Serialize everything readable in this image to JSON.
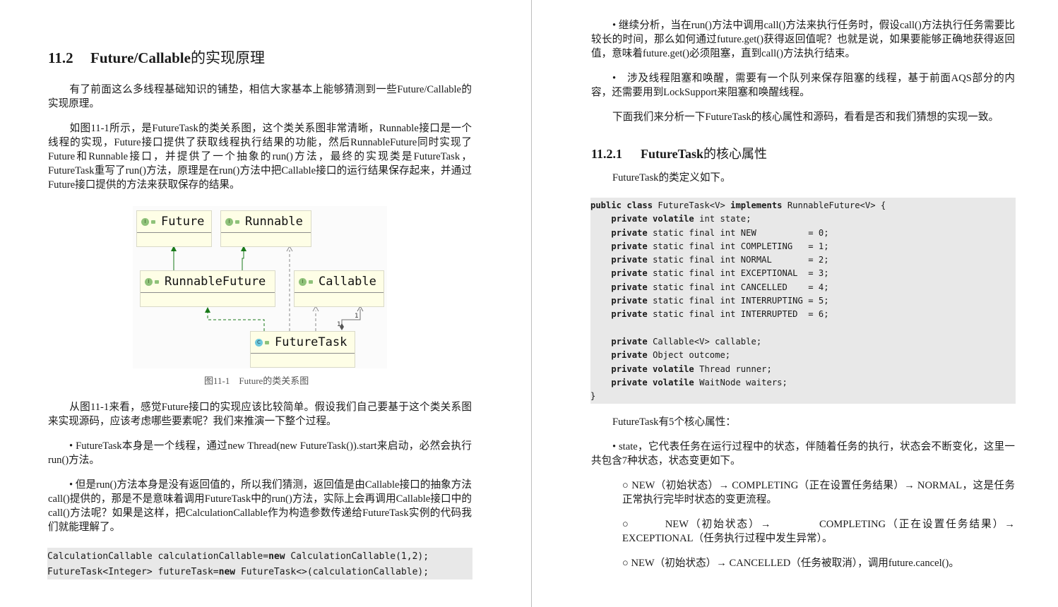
{
  "left_page": {
    "heading": {
      "number": "11.2",
      "title_latin": "Future/Callable",
      "title_zh": "的实现原理"
    },
    "paragraphs": [
      "有了前面这么多线程基础知识的铺垫，相信大家基本上能够猜测到一些Future/Callable的实现原理。",
      "如图11-1所示，是FutureTask的类关系图，这个类关系图非常清晰，Runnable接口是一个线程的实现，Future接口提供了获取线程执行结果的功能，然后RunnableFuture同时实现了Future和Runnable接口，并提供了一个抽象的run()方法，最终的实现类是FutureTask，FutureTask重写了run()方法，原理是在run()方法中把Callable接口的运行结果保存起来，并通过Future接口提供的方法来获取保存的结果。"
    ],
    "figure": {
      "caption": "图11-1　Future的类关系图",
      "nodes": [
        {
          "name": "Future",
          "kind": "I"
        },
        {
          "name": "Runnable",
          "kind": "I"
        },
        {
          "name": "RunnableFuture",
          "kind": "I"
        },
        {
          "name": "Callable",
          "kind": "I"
        },
        {
          "name": "FutureTask",
          "kind": "C"
        }
      ],
      "edges": [
        {
          "from": "RunnableFuture",
          "to": "Future",
          "type": "extends"
        },
        {
          "from": "RunnableFuture",
          "to": "Runnable",
          "type": "extends"
        },
        {
          "from": "FutureTask",
          "to": "RunnableFuture",
          "type": "implements"
        },
        {
          "from": "FutureTask",
          "to": "Runnable",
          "type": "dependency"
        },
        {
          "from": "FutureTask",
          "to": "Callable",
          "type": "dependency"
        },
        {
          "from": "FutureTask",
          "to": "Callable",
          "type": "composition",
          "label_from": "1",
          "label_to": "1"
        }
      ]
    },
    "paragraphs2": [
      "从图11-1来看，感觉Future接口的实现应该比较简单。假设我们自己要基于这个类关系图来实现源码，应该考虑哪些要素呢？我们来推演一下整个过程。",
      "• FutureTask本身是一个线程，通过new Thread(new FutureTask()).start来启动，必然会执行run()方法。",
      "• 但是run()方法本身是没有返回值的，所以我们猜测，返回值是由Callable接口的抽象方法call()提供的，那是不是意味着调用FutureTask中的run()方法，实际上会再调用Callable接口中的call()方法呢？如果是这样，把CalculationCallable作为构造参数传递给FutureTask实例的代码我们就能理解了。"
    ],
    "code": [
      [
        {
          "t": "CalculationCallable calculationCallable="
        },
        {
          "t": "new",
          "b": true
        },
        {
          "t": " CalculationCallable(1,2);"
        }
      ],
      [
        {
          "t": "FutureTask<Integer> futureTask="
        },
        {
          "t": "new",
          "b": true
        },
        {
          "t": " FutureTask<>(calculationCallable);"
        }
      ]
    ]
  },
  "right_page": {
    "paragraphs": [
      "• 继续分析，当在run()方法中调用call()方法来执行任务时，假设call()方法执行任务需要比较长的时间，那么如何通过future.get()获得返回值呢？也就是说，如果要能够正确地获得返回值，意味着future.get()必须阻塞，直到call()方法执行结束。",
      "•　涉及线程阻塞和唤醒，需要有一个队列来保存阻塞的线程，基于前面AQS部分的内容，还需要用到LockSupport来阻塞和唤醒线程。",
      "下面我们来分析一下FutureTask的核心属性和源码，看看是否和我们猜想的实现一致。"
    ],
    "heading": {
      "number": "11.2.1",
      "title_latin": "FutureTask",
      "title_zh": "的核心属性"
    },
    "intro": "FutureTask的类定义如下。",
    "code": [
      [
        {
          "t": "public class",
          "b": true
        },
        {
          "t": " FutureTask<V> "
        },
        {
          "t": "implements",
          "b": true
        },
        {
          "t": " RunnableFuture<V> {"
        }
      ],
      [
        {
          "t": "    "
        },
        {
          "t": "private volatile",
          "b": true
        },
        {
          "t": " int state;"
        }
      ],
      [
        {
          "t": "    "
        },
        {
          "t": "private",
          "b": true
        },
        {
          "t": " static final int NEW          = 0;"
        }
      ],
      [
        {
          "t": "    "
        },
        {
          "t": "private",
          "b": true
        },
        {
          "t": " static final int COMPLETING   = 1;"
        }
      ],
      [
        {
          "t": "    "
        },
        {
          "t": "private",
          "b": true
        },
        {
          "t": " static final int NORMAL       = 2;"
        }
      ],
      [
        {
          "t": "    "
        },
        {
          "t": "private",
          "b": true
        },
        {
          "t": " static final int EXCEPTIONAL  = 3;"
        }
      ],
      [
        {
          "t": "    "
        },
        {
          "t": "private",
          "b": true
        },
        {
          "t": " static final int CANCELLED    = 4;"
        }
      ],
      [
        {
          "t": "    "
        },
        {
          "t": "private",
          "b": true
        },
        {
          "t": " static final int INTERRUPTING = 5;"
        }
      ],
      [
        {
          "t": "    "
        },
        {
          "t": "private",
          "b": true
        },
        {
          "t": " static final int INTERRUPTED  = 6;"
        }
      ],
      [
        {
          "t": ""
        }
      ],
      [
        {
          "t": "    "
        },
        {
          "t": "private",
          "b": true
        },
        {
          "t": " Callable<V> callable;"
        }
      ],
      [
        {
          "t": "    "
        },
        {
          "t": "private",
          "b": true
        },
        {
          "t": " Object outcome;"
        }
      ],
      [
        {
          "t": "    "
        },
        {
          "t": "private volatile",
          "b": true
        },
        {
          "t": " Thread runner;"
        }
      ],
      [
        {
          "t": "    "
        },
        {
          "t": "private volatile",
          "b": true
        },
        {
          "t": " WaitNode waiters;"
        }
      ],
      [
        {
          "t": "}"
        }
      ]
    ],
    "after_code": "FutureTask有5个核心属性：",
    "state_bullet": "• state，它代表任务在运行过程中的状态，伴随着任务的执行，状态会不断变化，这里一共包含7种状态，状态变更如下。",
    "transitions": [
      "○ NEW（初始状态）→ COMPLETING（正在设置任务结果）→ NORMAL，这是任务正常执行完毕时状态的变更流程。",
      "○　　　NEW（初始状态）→　　　　COMPLETING（正在设置任务结果）→ EXCEPTIONAL（任务执行过程中发生异常）。",
      "○ NEW（初始状态）→ CANCELLED（任务被取消），调用future.cancel()。"
    ]
  }
}
